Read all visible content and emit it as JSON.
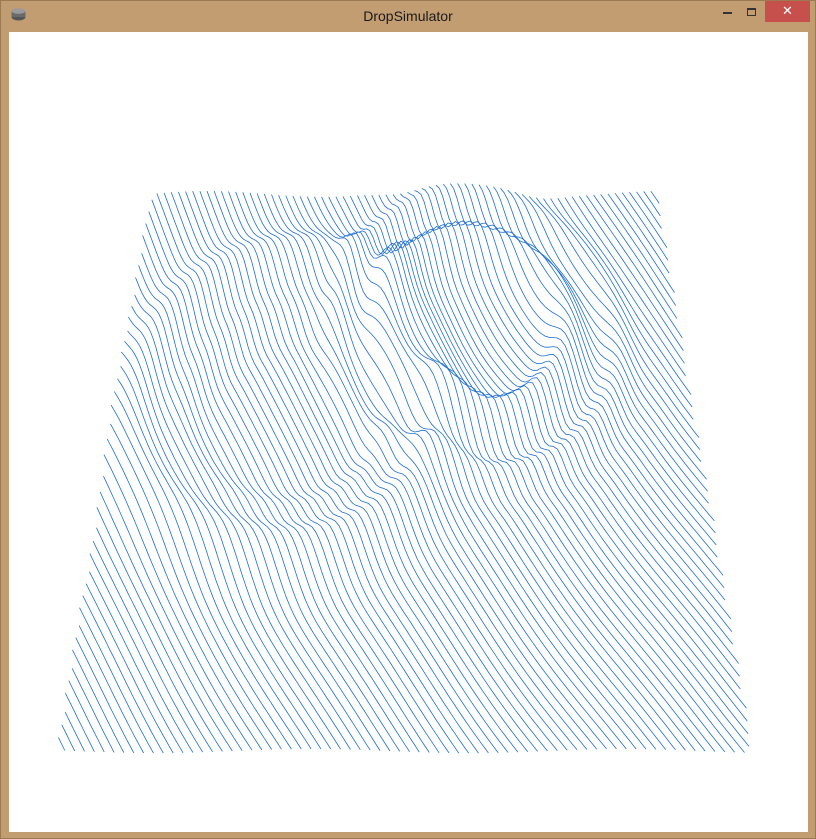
{
  "window": {
    "title": "DropSimulator",
    "close_glyph": "✕",
    "icons": {
      "app": "app-icon",
      "minimize": "minimize-icon",
      "maximize": "maximize-icon",
      "close": "close-icon"
    }
  },
  "simulation": {
    "description_kind": "wireframe-wave-surface",
    "line_color": "#1f6fd1",
    "background_color": "#ffffff"
  }
}
